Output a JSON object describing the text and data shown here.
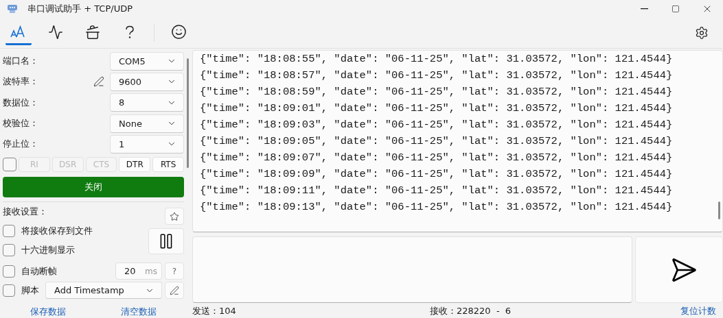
{
  "window": {
    "title": "串口调试助手 + TCP/UDP"
  },
  "toolbar": {
    "tabs": [
      {
        "kind": "font",
        "selected": true
      },
      {
        "kind": "pulse",
        "selected": false
      },
      {
        "kind": "tools",
        "selected": false
      },
      {
        "kind": "help",
        "selected": false
      },
      {
        "kind": "smile",
        "selected": false
      }
    ]
  },
  "port_settings": [
    {
      "label": "端口名：",
      "value": "COM5",
      "edit_icon": false
    },
    {
      "label": "波特率：",
      "value": "9600",
      "edit_icon": true
    },
    {
      "label": "数据位：",
      "value": "8",
      "edit_icon": false
    },
    {
      "label": "校验位：",
      "value": "None",
      "edit_icon": false
    },
    {
      "label": "停止位：",
      "value": "1",
      "edit_icon": false
    }
  ],
  "signals": {
    "checked": false,
    "pins": [
      {
        "label": "RI",
        "disabled": true
      },
      {
        "label": "DSR",
        "disabled": true
      },
      {
        "label": "CTS",
        "disabled": true
      },
      {
        "label": "DTR",
        "disabled": false
      },
      {
        "label": "RTS",
        "disabled": false
      }
    ]
  },
  "connect_button": "关闭",
  "receive_settings": {
    "title": "接收设置：",
    "options": [
      {
        "kind": "plain",
        "label": "将接收保存到文件",
        "checked": false
      },
      {
        "kind": "plain",
        "label": "十六进制显示",
        "checked": false
      },
      {
        "kind": "timeout",
        "label": "自动断帧",
        "checked": false,
        "value": "20",
        "unit": "ms",
        "help": "?"
      },
      {
        "kind": "script",
        "label": "脚本",
        "checked": false,
        "value": "Add Timestamp"
      }
    ]
  },
  "links": [
    "保存数据",
    "清空数据"
  ],
  "log": [
    "{\"time\": \"18:08:55\", \"date\": \"06-11-25\", \"lat\": 31.03572, \"lon\": 121.4544}",
    "{\"time\": \"18:08:57\", \"date\": \"06-11-25\", \"lat\": 31.03572, \"lon\": 121.4544}",
    "{\"time\": \"18:08:59\", \"date\": \"06-11-25\", \"lat\": 31.03572, \"lon\": 121.4544}",
    "{\"time\": \"18:09:01\", \"date\": \"06-11-25\", \"lat\": 31.03572, \"lon\": 121.4544}",
    "{\"time\": \"18:09:03\", \"date\": \"06-11-25\", \"lat\": 31.03572, \"lon\": 121.4544}",
    "{\"time\": \"18:09:05\", \"date\": \"06-11-25\", \"lat\": 31.03572, \"lon\": 121.4544}",
    "{\"time\": \"18:09:07\", \"date\": \"06-11-25\", \"lat\": 31.03572, \"lon\": 121.4544}",
    "{\"time\": \"18:09:09\", \"date\": \"06-11-25\", \"lat\": 31.03572, \"lon\": 121.4544}",
    "{\"time\": \"18:09:11\", \"date\": \"06-11-25\", \"lat\": 31.03572, \"lon\": 121.4544}",
    "{\"time\": \"18:09:13\", \"date\": \"06-11-25\", \"lat\": 31.03572, \"lon\": 121.4544}"
  ],
  "status_bar": {
    "sent": "发送：104",
    "received": "接收：228220  -  6",
    "reset_link": "复位计数"
  }
}
